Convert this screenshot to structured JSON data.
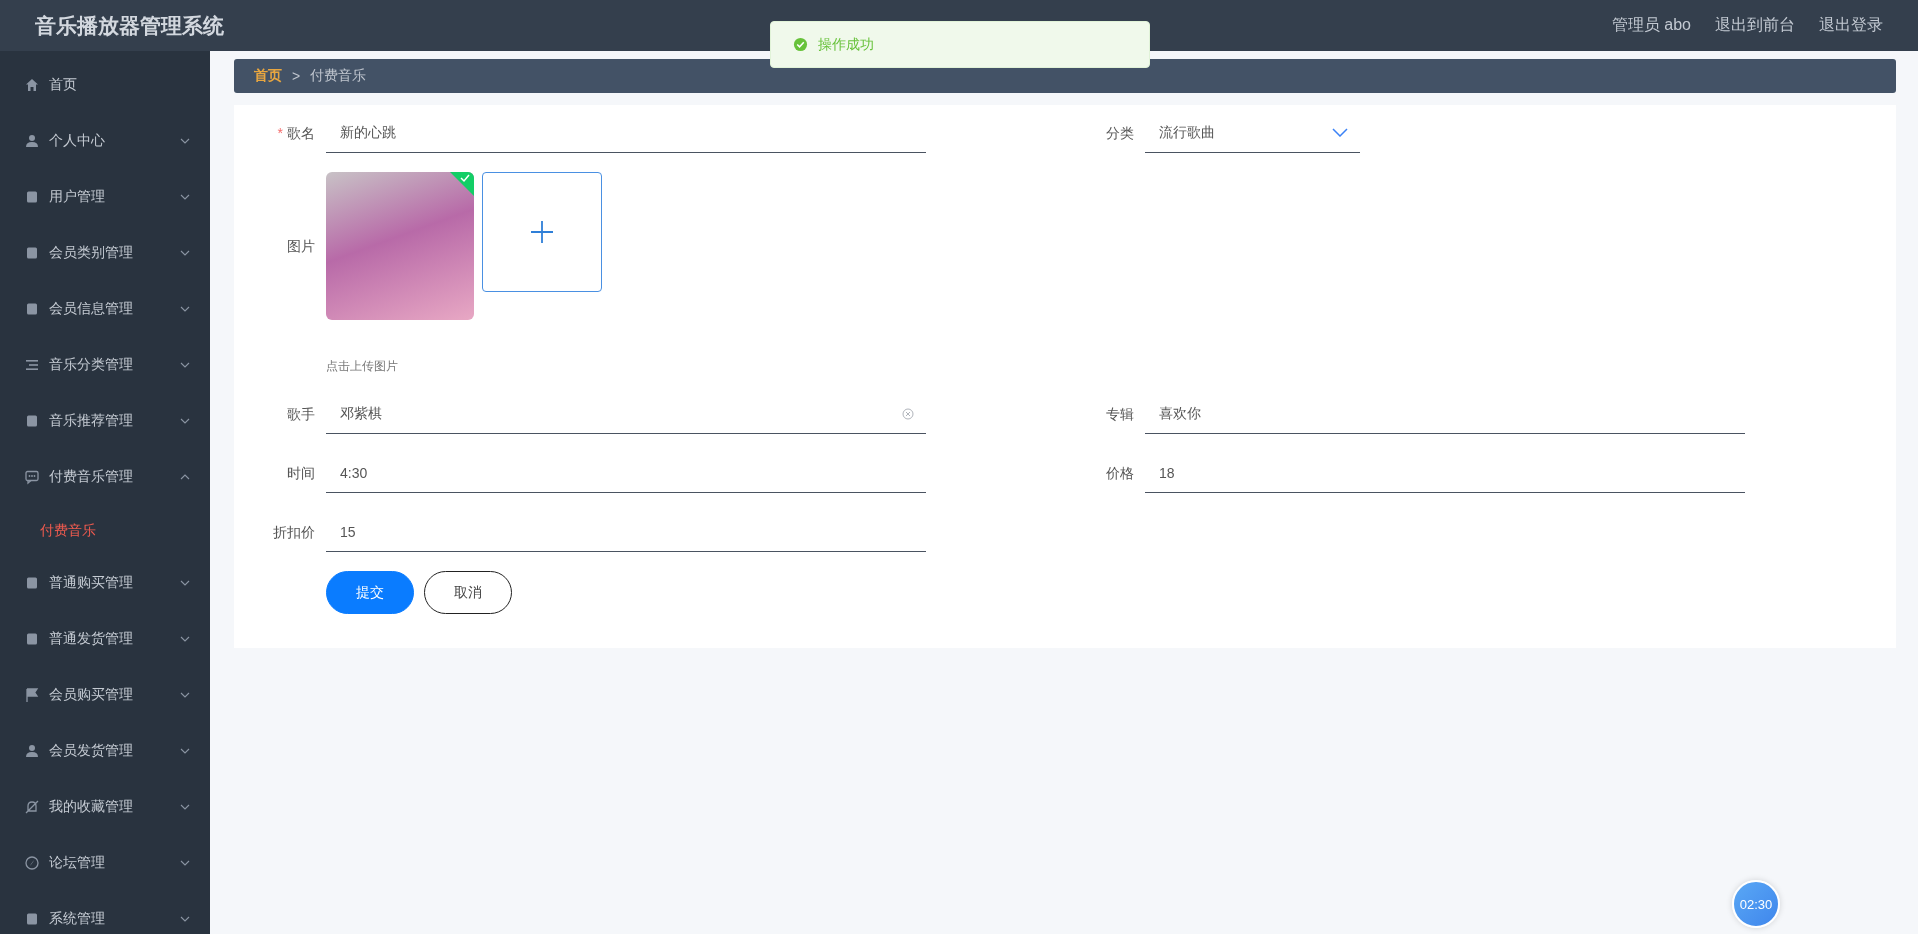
{
  "header": {
    "title": "音乐播放器管理系统",
    "links": [
      {
        "label": "管理员 abo"
      },
      {
        "label": "退出到前台"
      },
      {
        "label": "退出登录"
      }
    ]
  },
  "toast": {
    "kind": "success",
    "message": "操作成功"
  },
  "sidebar": {
    "items": [
      {
        "label": "首页"
      },
      {
        "label": "个人中心",
        "expanded": false
      },
      {
        "label": "用户管理",
        "expanded": false
      },
      {
        "label": "会员类别管理",
        "expanded": false
      },
      {
        "label": "会员信息管理",
        "expanded": false
      },
      {
        "label": "音乐分类管理",
        "expanded": false
      },
      {
        "label": "音乐推荐管理",
        "expanded": false
      },
      {
        "label": "付费音乐管理",
        "expanded": true,
        "children": [
          {
            "label": "付费音乐",
            "selected": true
          }
        ]
      },
      {
        "label": "普通购买管理",
        "expanded": false
      },
      {
        "label": "普通发货管理",
        "expanded": false
      },
      {
        "label": "会员购买管理",
        "expanded": false
      },
      {
        "label": "会员发货管理",
        "expanded": false
      },
      {
        "label": "我的收藏管理",
        "expanded": false
      },
      {
        "label": "论坛管理",
        "expanded": false
      },
      {
        "label": "系统管理",
        "expanded": false
      }
    ]
  },
  "breadcrumb": [
    {
      "label": "首页",
      "selected": false
    },
    {
      "label": "付费音乐",
      "selected": true
    }
  ],
  "breadcrumb_separator": ">",
  "form": {
    "rows": [
      {
        "cells": [
          {
            "kind": "text",
            "label": "歌名",
            "value": "新的心跳",
            "required_mark": "*"
          },
          {
            "kind": "select",
            "label": "分类",
            "value": "流行歌曲"
          }
        ]
      },
      {
        "cells": [
          {
            "kind": "upload",
            "label": "图片",
            "hint": "点击上传图片",
            "uploaded": true
          }
        ]
      },
      {
        "cells": [
          {
            "kind": "text",
            "label": "歌手",
            "value": "邓紫棋",
            "clearable": true
          },
          {
            "kind": "text",
            "label": "专辑",
            "value": "喜欢你",
            "clearable": false
          }
        ]
      },
      {
        "cells": [
          {
            "kind": "text",
            "label": "时间",
            "value": "4:30",
            "clearable": false
          },
          {
            "kind": "text",
            "label": "价格",
            "value": "18",
            "clearable": false
          }
        ]
      },
      {
        "cells": [
          {
            "kind": "text",
            "label": "折扣价",
            "value": "15",
            "clearable": false
          }
        ]
      }
    ],
    "buttons": [
      {
        "label": "提交",
        "kind": "primary"
      },
      {
        "label": "取消",
        "kind": "plain"
      }
    ]
  },
  "timer": {
    "label": "02:30"
  }
}
